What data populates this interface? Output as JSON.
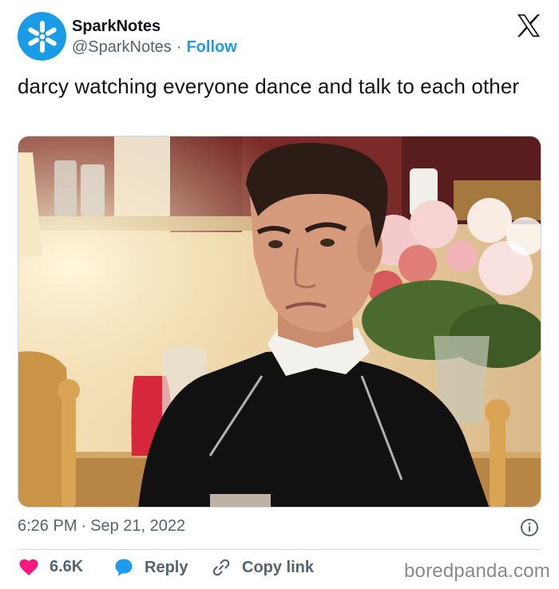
{
  "author": {
    "name": "SparkNotes",
    "handle": "@SparkNotes",
    "separator": "·",
    "follow_label": "Follow"
  },
  "tweet": {
    "text": "darcy watching everyone dance and talk to each other"
  },
  "meta": {
    "time": "6:26 PM",
    "separator": "·",
    "date": "Sep 21, 2022"
  },
  "actions": {
    "likes": "6.6K",
    "reply_label": "Reply",
    "copy_label": "Copy link"
  },
  "watermark": "boredpanda.com",
  "icons": {
    "avatar": "sparknotes-asterisk-logo",
    "brand": "x-logo",
    "info": "info-icon",
    "like": "heart-icon",
    "reply": "speech-bubble-icon",
    "copy": "link-icon"
  },
  "colors": {
    "accent": "#1d9bf0",
    "like": "#f91880",
    "avatar_bg": "#1a9be6",
    "muted": "#536471",
    "text": "#0f1419"
  }
}
